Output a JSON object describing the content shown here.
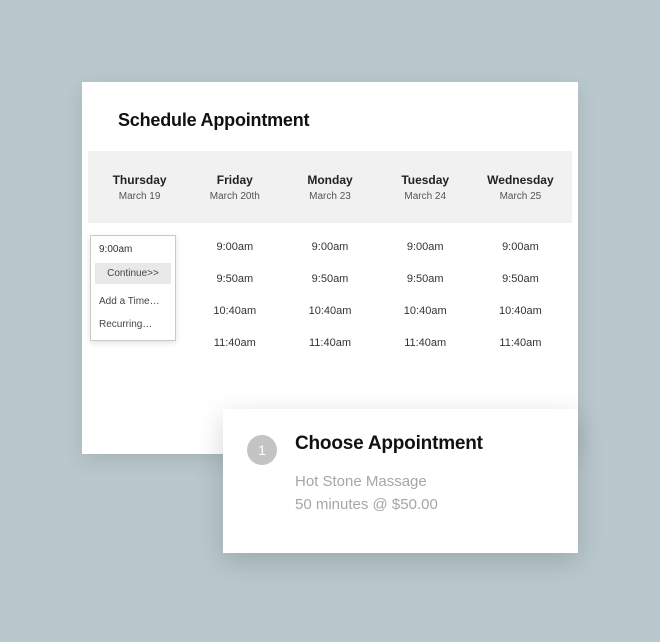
{
  "schedule": {
    "title": "Schedule Appointment",
    "days": [
      {
        "name": "Thursday",
        "date": "March 19"
      },
      {
        "name": "Friday",
        "date": "March 20th"
      },
      {
        "name": "Monday",
        "date": "March 23"
      },
      {
        "name": "Tuesday",
        "date": "March 24"
      },
      {
        "name": "Wednesday",
        "date": "March 25"
      }
    ],
    "times": [
      "9:00am",
      "9:50am",
      "10:40am",
      "11:40am"
    ]
  },
  "popover": {
    "selected_time": "9:00am",
    "continue": "Continue>>",
    "add_time": "Add a Time…",
    "recurring": "Recurring…"
  },
  "choose": {
    "step": "1",
    "heading": "Choose Appointment",
    "service": "Hot Stone Massage",
    "detail": "50 minutes @ $50.00"
  }
}
